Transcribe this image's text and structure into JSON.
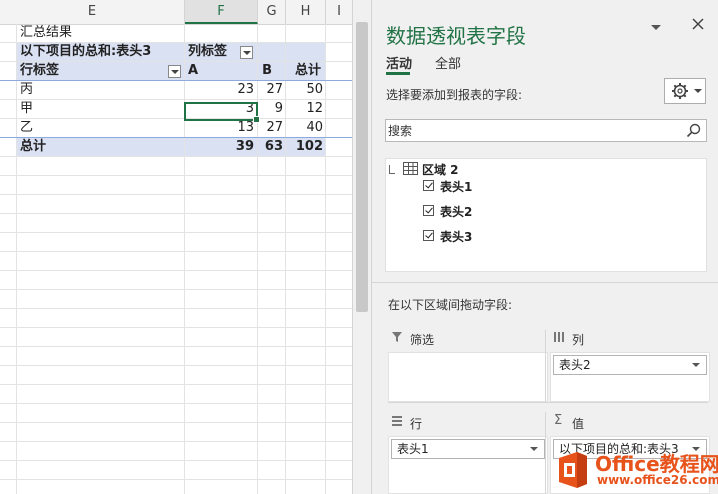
{
  "sheet": {
    "columns": [
      "E",
      "F",
      "G",
      "H",
      "I"
    ],
    "rows": {
      "r1": {
        "e": "汇总结果"
      },
      "r2": {
        "e": "以下项目的总和:表头3",
        "f": "列标签"
      },
      "r3": {
        "e": "行标签",
        "f": "A",
        "g": "B",
        "h": "总计"
      },
      "data": [
        {
          "label": "丙",
          "a": "23",
          "b": "27",
          "total": "50"
        },
        {
          "label": "甲",
          "a": "3",
          "b": "9",
          "total": "12"
        },
        {
          "label": "乙",
          "a": "13",
          "b": "27",
          "total": "40"
        }
      ],
      "grand": {
        "label": "总计",
        "a": "39",
        "b": "63",
        "total": "102"
      }
    },
    "band_color": "#dae1f3",
    "selection_color": "#217346"
  },
  "pane": {
    "title": "数据透视表字段",
    "tabs": [
      "活动",
      "全部"
    ],
    "active_tab": "活动",
    "choose_label": "选择要添加到报表的字段:",
    "search_placeholder": "搜索",
    "table_name": "区域 2",
    "fields": [
      {
        "label": "表头1",
        "checked": true
      },
      {
        "label": "表头2",
        "checked": true
      },
      {
        "label": "表头3",
        "checked": true
      }
    ],
    "drag_label": "在以下区域间拖动字段:",
    "areas": {
      "filter": {
        "label": "筛选"
      },
      "columns": {
        "label": "列",
        "value": "表头2"
      },
      "rows": {
        "label": "行",
        "value": "表头1"
      },
      "values": {
        "label": "值",
        "value": "以下项目的总和:表头3"
      }
    },
    "accent_color": "#217346"
  },
  "watermark": {
    "brand": "Office教程网",
    "url": "www.office26.com"
  }
}
